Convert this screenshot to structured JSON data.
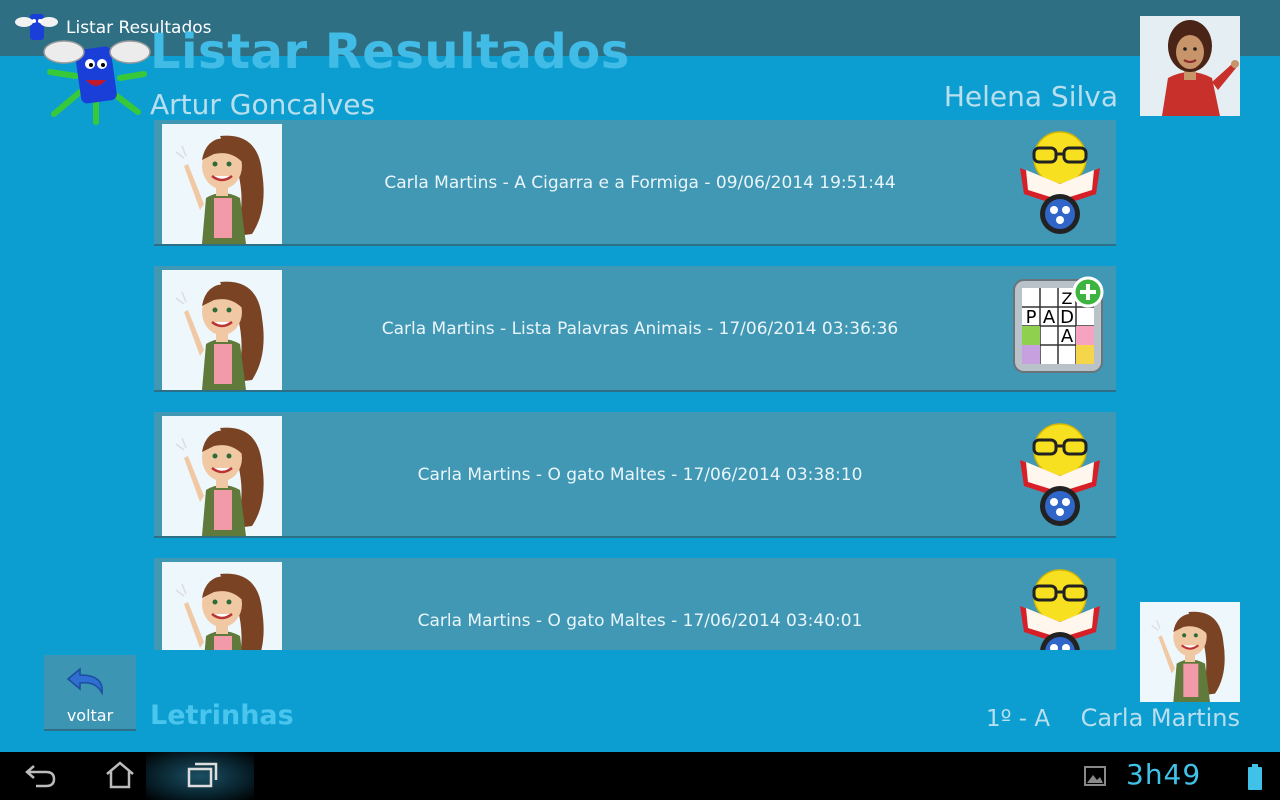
{
  "actionbar": {
    "title": "Listar Resultados",
    "logo_icon": "letrinhas-mascot-icon"
  },
  "header": {
    "title": "Listar Resultados",
    "student_name": "Artur Goncalves",
    "teacher_name": "Helena Silva"
  },
  "results": [
    {
      "label": "Carla Martins - A Cigarra e a Formiga - 09/06/2014 19:51:44",
      "icon": "reading-test-icon"
    },
    {
      "label": "Carla Martins - Lista Palavras Animais - 17/06/2014 03:36:36",
      "icon": "word-puzzle-icon"
    },
    {
      "label": "Carla Martins - O gato Maltes - 17/06/2014 03:38:10",
      "icon": "reading-test-icon"
    },
    {
      "label": "Carla Martins - O gato Maltes - 17/06/2014 03:40:01",
      "icon": "reading-test-icon"
    }
  ],
  "footer": {
    "back_label": "voltar",
    "app_name": "Letrinhas",
    "class_label": "1º - A",
    "student_name": "Carla Martins"
  },
  "puzzle_letters": [
    "P",
    "A",
    "D",
    "A",
    "Z"
  ],
  "statusbar": {
    "time": "3h49"
  },
  "colors": {
    "background": "#0d9ed1",
    "actionbar": "#2e6f84",
    "row": "#4198b4",
    "accent": "#4ac6ee"
  }
}
